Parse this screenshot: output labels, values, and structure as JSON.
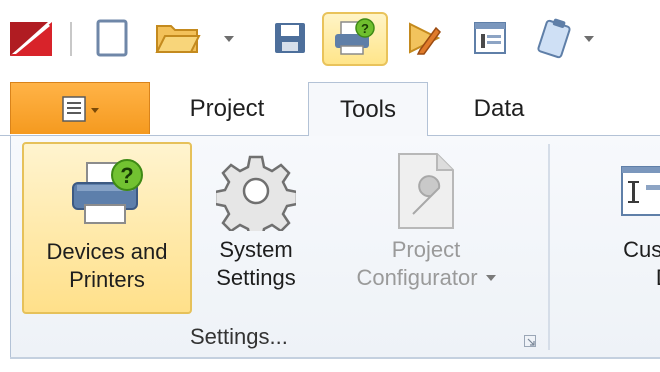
{
  "quick_access": {
    "icons": [
      "app-logo-icon",
      "new-document-icon",
      "open-folder-icon",
      "dropdown-arrow-icon",
      "save-icon",
      "printer-help-icon",
      "pencil-ruler-icon",
      "editor-icon",
      "clipboard-icon"
    ]
  },
  "tabs": [
    {
      "label": "Project"
    },
    {
      "label": "Tools"
    },
    {
      "label": "Data"
    }
  ],
  "ribbon": {
    "devices_line1": "Devices and",
    "devices_line2": "Printers",
    "system_line1": "System",
    "system_line2": "Settings",
    "project_line1": "Project",
    "project_line2": "Configurator",
    "custom_line1": "Custom",
    "custom_line2": "Desig",
    "group_label": "Settings..."
  },
  "colors": {
    "app_menu": "#f5a02a",
    "active_highlight": "#ffe08a",
    "ribbon_border": "#b3c2d6"
  }
}
